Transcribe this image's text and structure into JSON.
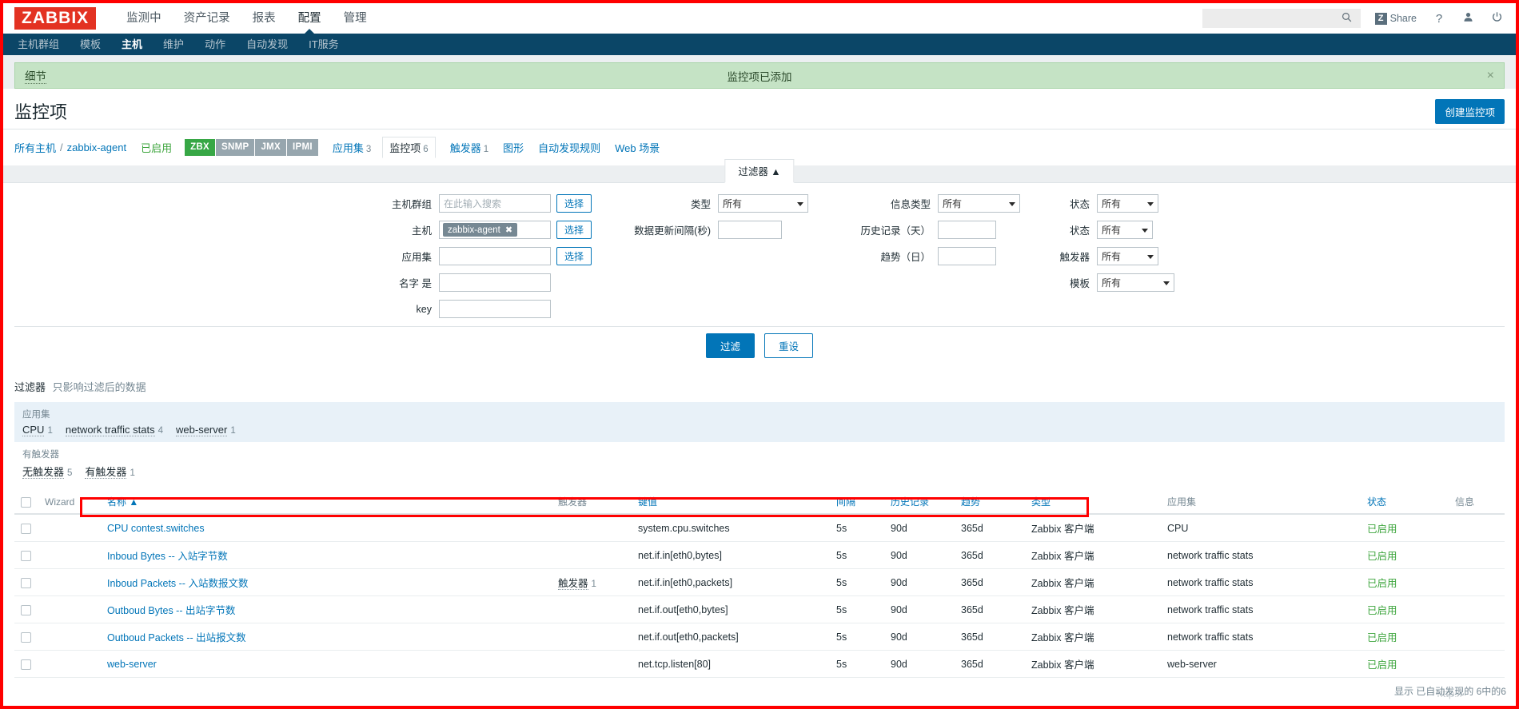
{
  "brand": {
    "logo": "ZABBIX"
  },
  "topnav": {
    "items": [
      {
        "label": "监测中",
        "active": false
      },
      {
        "label": "资产记录",
        "active": false
      },
      {
        "label": "报表",
        "active": false
      },
      {
        "label": "配置",
        "active": true
      },
      {
        "label": "管理",
        "active": false
      }
    ],
    "search": {
      "value": "",
      "placeholder": ""
    },
    "search_icon": "search-icon",
    "share": {
      "badge": "Z",
      "label": "Share"
    },
    "help_icon": "?",
    "user_icon": "user-icon",
    "power_icon": "power-icon"
  },
  "subnav": {
    "items": [
      {
        "label": "主机群组",
        "active": false
      },
      {
        "label": "模板",
        "active": false
      },
      {
        "label": "主机",
        "active": true
      },
      {
        "label": "维护",
        "active": false
      },
      {
        "label": "动作",
        "active": false
      },
      {
        "label": "自动发现",
        "active": false
      },
      {
        "label": "IT服务",
        "active": false
      }
    ]
  },
  "message": {
    "details_label": "细节",
    "text": "监控项已添加",
    "close": "×"
  },
  "header": {
    "title": "监控项",
    "create_button": "创建监控项"
  },
  "breadcrumb": {
    "all_hosts": "所有主机",
    "separator": "/",
    "host": "zabbix-agent",
    "enabled": "已启用",
    "interfaces": [
      {
        "label": "ZBX",
        "active": true
      },
      {
        "label": "SNMP",
        "active": false
      },
      {
        "label": "JMX",
        "active": false
      },
      {
        "label": "IPMI",
        "active": false
      }
    ],
    "tabs": [
      {
        "label": "应用集",
        "count": "3",
        "selected": false
      },
      {
        "label": "监控项",
        "count": "6",
        "selected": true
      },
      {
        "label": "触发器",
        "count": "1",
        "selected": false
      },
      {
        "label": "图形",
        "count": "",
        "selected": false
      },
      {
        "label": "自动发现规则",
        "count": "",
        "selected": false
      },
      {
        "label": "Web 场景",
        "count": "",
        "selected": false
      }
    ]
  },
  "filter": {
    "tab_label": "过滤器 ▲",
    "col1": [
      {
        "label": "主机群组",
        "type": "input",
        "value": "",
        "placeholder": "在此输入搜索",
        "button": "选择"
      },
      {
        "label": "主机",
        "type": "chip",
        "chip": "zabbix-agent",
        "chip_remove": "✖",
        "button": "选择"
      },
      {
        "label": "应用集",
        "type": "input",
        "value": "",
        "placeholder": "",
        "button": "选择"
      },
      {
        "label": "名字 是",
        "type": "input",
        "value": "",
        "placeholder": ""
      },
      {
        "label": "key",
        "type": "input",
        "value": "",
        "placeholder": ""
      }
    ],
    "col2": [
      {
        "label": "类型",
        "type": "select",
        "value": "所有"
      },
      {
        "label": "数据更新间隔(秒)",
        "type": "input",
        "value": ""
      }
    ],
    "col3": [
      {
        "label": "信息类型",
        "type": "select",
        "value": "所有"
      },
      {
        "label": "历史记录（天）",
        "type": "input",
        "value": ""
      },
      {
        "label": "趋势（日）",
        "type": "input",
        "value": ""
      }
    ],
    "col4": [
      {
        "label": "状态",
        "type": "select",
        "value": "所有"
      },
      {
        "label": "状态",
        "type": "select",
        "value": "所有"
      },
      {
        "label": "触发器",
        "type": "select",
        "value": "所有"
      },
      {
        "label": "模板",
        "type": "select",
        "value": "所有"
      }
    ],
    "apply_button": "过滤",
    "reset_button": "重设",
    "note_bold": "过滤器",
    "note_text": "只影响过滤后的数据"
  },
  "subfilter": {
    "apps_title": "应用集",
    "apps": [
      {
        "label": "CPU",
        "count": "1"
      },
      {
        "label": "network traffic stats",
        "count": "4"
      },
      {
        "label": "web-server",
        "count": "1"
      }
    ],
    "triggers_title": "有触发器",
    "triggers": [
      {
        "label": "无触发器",
        "count": "5"
      },
      {
        "label": "有触发器",
        "count": "1"
      }
    ]
  },
  "table": {
    "headers": {
      "checkbox": "",
      "wizard": "Wizard",
      "name": "名称 ▲",
      "trigger": "触发器",
      "key": "键值",
      "interval": "间隔",
      "history": "历史记录",
      "trend": "趋势",
      "type": "类型",
      "app": "应用集",
      "status": "状态",
      "info": "信息"
    },
    "rows": [
      {
        "name": "CPU contest.switches",
        "trigger": "",
        "trigger_count": "",
        "key": "system.cpu.switches",
        "interval": "5s",
        "history": "90d",
        "trend": "365d",
        "type": "Zabbix 客户端",
        "app": "CPU",
        "status": "已启用",
        "info": ""
      },
      {
        "name": "Inboud Bytes -- 入站字节数",
        "trigger": "",
        "trigger_count": "",
        "key": "net.if.in[eth0,bytes]",
        "interval": "5s",
        "history": "90d",
        "trend": "365d",
        "type": "Zabbix 客户端",
        "app": "network traffic stats",
        "status": "已启用",
        "info": ""
      },
      {
        "name": "Inboud Packets -- 入站数报文数",
        "trigger": "触发器",
        "trigger_count": "1",
        "key": "net.if.in[eth0,packets]",
        "interval": "5s",
        "history": "90d",
        "trend": "365d",
        "type": "Zabbix 客户端",
        "app": "network traffic stats",
        "status": "已启用",
        "info": ""
      },
      {
        "name": "Outboud Bytes -- 出站字节数",
        "trigger": "",
        "trigger_count": "",
        "key": "net.if.out[eth0,bytes]",
        "interval": "5s",
        "history": "90d",
        "trend": "365d",
        "type": "Zabbix 客户端",
        "app": "network traffic stats",
        "status": "已启用",
        "info": ""
      },
      {
        "name": "Outboud Packets -- 出站报文数",
        "trigger": "",
        "trigger_count": "",
        "key": "net.if.out[eth0,packets]",
        "interval": "5s",
        "history": "90d",
        "trend": "365d",
        "type": "Zabbix 客户端",
        "app": "network traffic stats",
        "status": "已启用",
        "info": ""
      },
      {
        "name": "web-server",
        "trigger": "",
        "trigger_count": "",
        "key": "net.tcp.listen[80]",
        "interval": "5s",
        "history": "90d",
        "trend": "365d",
        "type": "Zabbix 客户端",
        "app": "web-server",
        "status": "已启用",
        "info": ""
      }
    ]
  },
  "footer": {
    "note": "显示 已自动发现的 6中的6",
    "watermark": "http://"
  },
  "colors": {
    "brand_red": "#e33222",
    "nav_dark": "#0b4667",
    "link_blue": "#0275b8",
    "ok_green": "#3da53d",
    "success_bg": "#c5e3c5",
    "annotation_red": "#ff0000"
  }
}
